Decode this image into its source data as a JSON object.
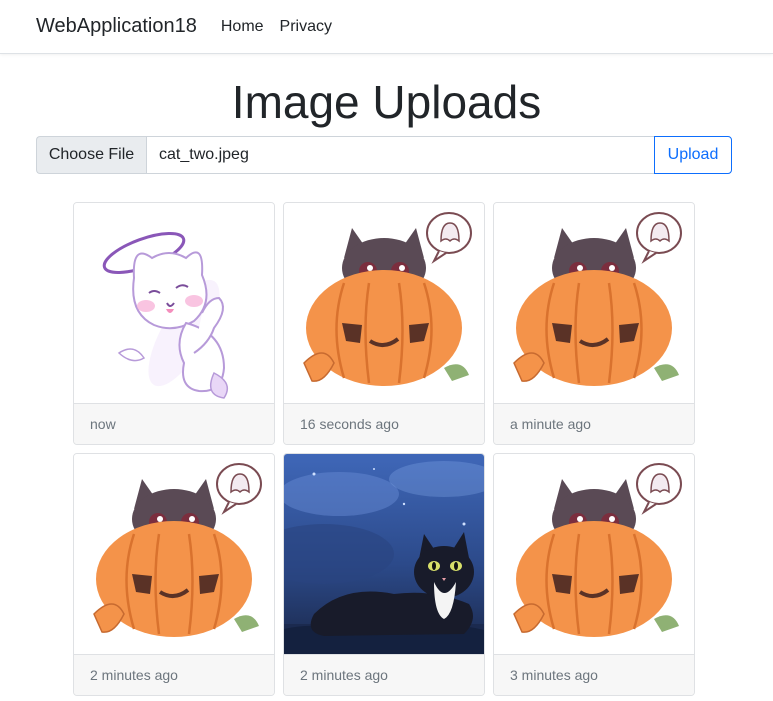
{
  "nav": {
    "brand": "WebApplication18",
    "links": [
      "Home",
      "Privacy"
    ]
  },
  "page": {
    "title": "Image Uploads"
  },
  "upload": {
    "choose_label": "Choose File",
    "file_name": "cat_two.jpeg",
    "upload_label": "Upload"
  },
  "cards": [
    {
      "image": "angel-cat-icon",
      "time": "now"
    },
    {
      "image": "pumpkin-cat-icon",
      "time": "16 seconds ago"
    },
    {
      "image": "pumpkin-cat-icon",
      "time": "a minute ago"
    },
    {
      "image": "pumpkin-cat-icon",
      "time": "2 minutes ago"
    },
    {
      "image": "night-cat-icon",
      "time": "2 minutes ago"
    },
    {
      "image": "pumpkin-cat-icon",
      "time": "3 minutes ago"
    }
  ],
  "colors": {
    "primary": "#0d6efd",
    "footer_bg": "#f7f7f7",
    "pumpkin": "#f4934a",
    "night_sky": "#2c4a8a"
  }
}
